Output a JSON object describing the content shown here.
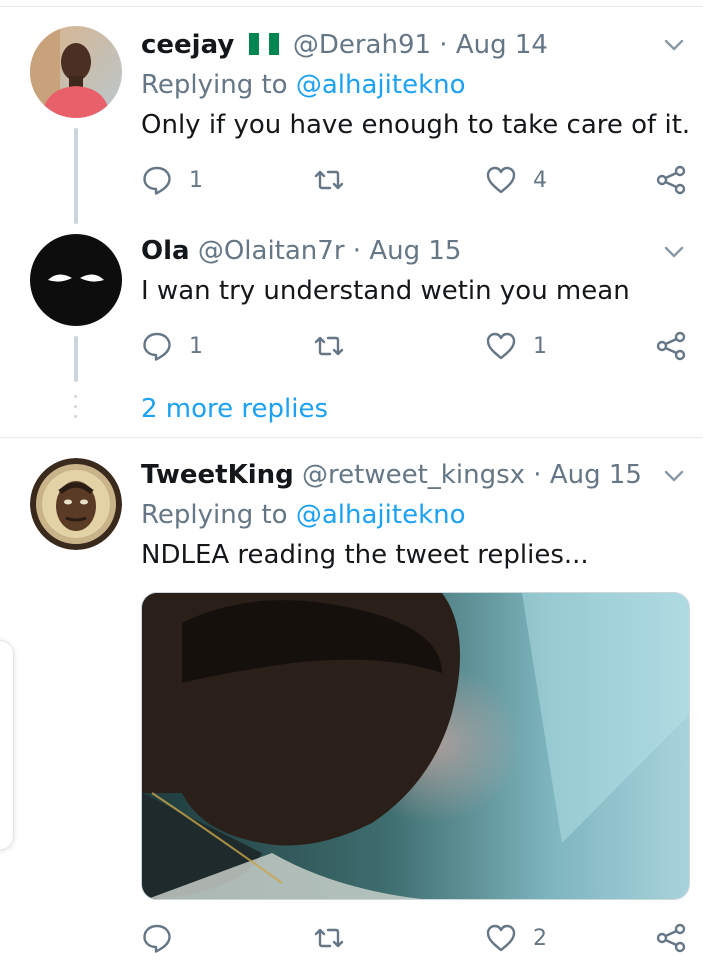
{
  "tweets": [
    {
      "name": "ceejay",
      "handle": "@Derah91",
      "separator": "·",
      "date": "Aug 14",
      "replying_prefix": "Replying to",
      "replying_to": "@alhajitekno",
      "text": "Only if you have enough to take care of it.",
      "replies": "1",
      "retweets": "",
      "likes": "4"
    },
    {
      "name": "Ola",
      "handle": "@Olaitan7r",
      "separator": "·",
      "date": "Aug 15",
      "text": "I wan try understand wetin you mean",
      "replies": "1",
      "retweets": "",
      "likes": "1"
    },
    {
      "name": "TweetKing",
      "handle": "@retweet_kingsx",
      "separator": "·",
      "date": "Aug 15",
      "replying_prefix": "Replying to",
      "replying_to": "@alhajitekno",
      "text": "NDLEA reading the tweet replies...",
      "replies": "",
      "retweets": "",
      "likes": "2"
    }
  ],
  "more_replies": "2 more replies",
  "icons": {
    "reply": "reply-icon",
    "retweet": "retweet-icon",
    "like": "heart-icon",
    "share": "share-icon",
    "menu": "chevron-down-icon",
    "flag": "nigeria-flag-icon"
  },
  "colors": {
    "link": "#1da1f2",
    "secondary_text": "#657786",
    "primary_text": "#14171a",
    "divider": "#e6ecf0",
    "thread_line": "#ccd6dd"
  }
}
